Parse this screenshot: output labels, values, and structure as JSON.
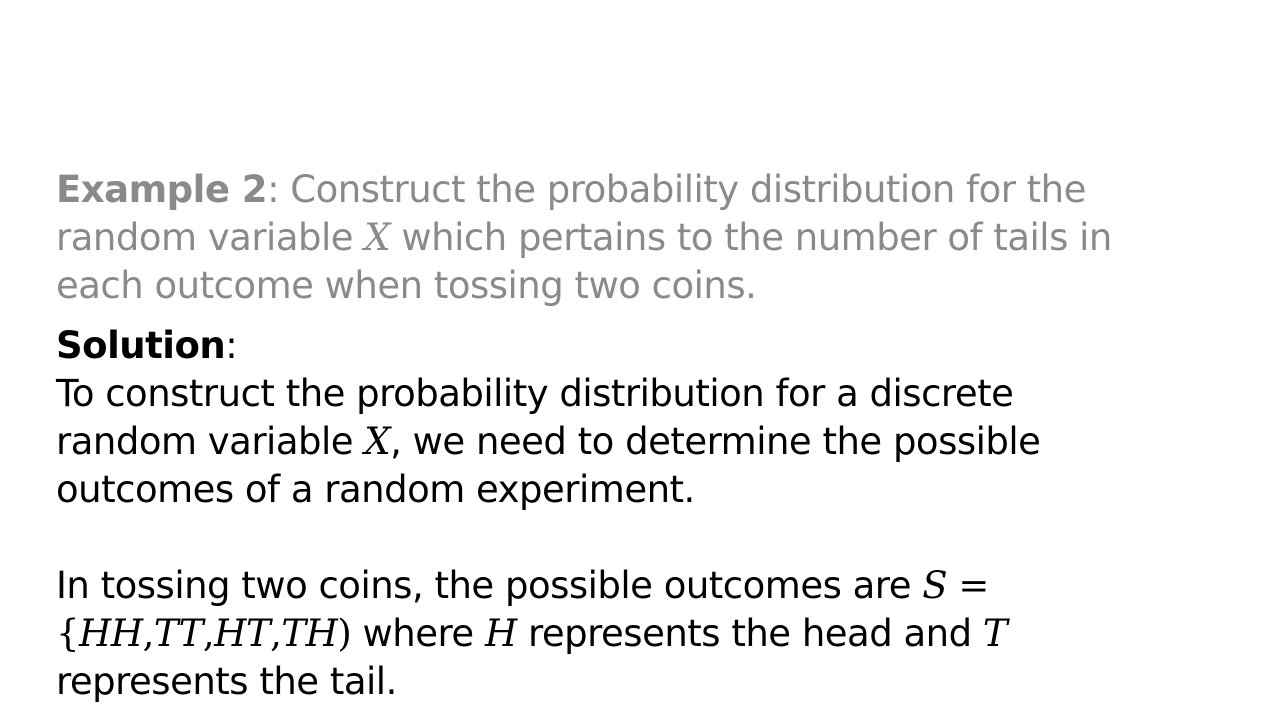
{
  "example": {
    "label": "Example 2",
    "sep": ":",
    "l1": " Construct the probability distribution for the",
    "l2a": "random variable ",
    "var_x": "X",
    "l2b": " which pertains to the number of tails in",
    "l3": "each outcome when tossing two coins."
  },
  "solution": {
    "label": "Solution",
    "sep": ":",
    "p1_l1": "To construct the probability distribution for a discrete",
    "p1_l2a": "random variable ",
    "var_x": "X",
    "p1_l2b": ", we need to determine the possible",
    "p1_l3": "outcomes of a random experiment.",
    "p2_l1a": "In tossing two coins, the possible outcomes are ",
    "var_s": "S",
    "eq": " =",
    "brace_open": "{",
    "o1": "HH",
    "comma": ",",
    "o2": "TT",
    "o3": "HT",
    "o4": "TH",
    "paren_close": ")",
    "p2_l2a": " where ",
    "var_h": "H",
    "p2_l2b": " represents the head and ",
    "var_t": "T",
    "p2_l3": "represents the tail."
  }
}
